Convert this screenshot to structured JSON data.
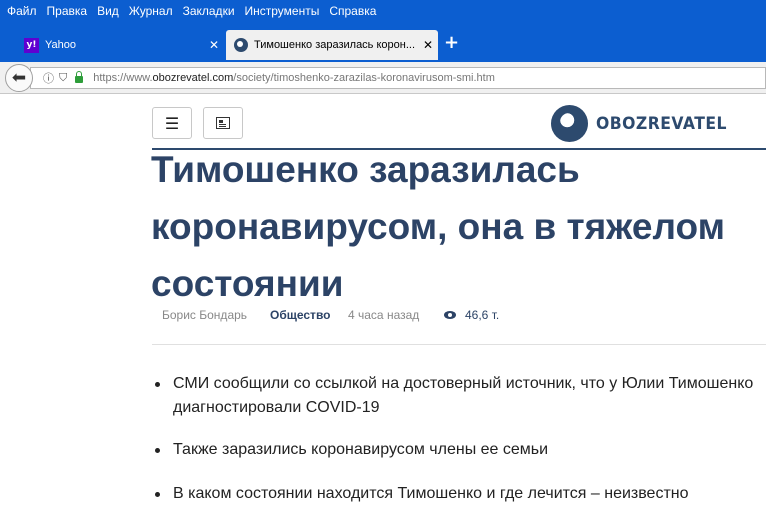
{
  "menu": [
    "Файл",
    "Правка",
    "Вид",
    "Журнал",
    "Закладки",
    "Инструменты",
    "Справка"
  ],
  "tabs": [
    {
      "title": "Yahoo",
      "favicon": "yahoo-icon"
    },
    {
      "title": "Тимошенко заразилась корон...",
      "favicon": "globe-icon"
    }
  ],
  "urlbar": {
    "url_prefix": "https://www.",
    "url_domain": "obozrevatel.com",
    "url_path": "/society/timoshenko-zarazilas-koronavirusom-smi.htm"
  },
  "brand": {
    "name": "OBOZREVATEL",
    "color": "#2d4a6e"
  },
  "article": {
    "headline": "Тимошенко заразилась коронавирусом, она в тяжелом состоянии",
    "author": "Борис Бондарь",
    "section": "Общество",
    "time": "4 часа назад",
    "views": "46,6 т.",
    "bullets": [
      "СМИ сообщили со ссылкой на достоверный источник, что у Юлии Тимошенко диагностировали COVID-19",
      "Также заразились коронавирусом члены ее семьи",
      "В каком состоянии находится Тимошенко и где лечится – неизвестно"
    ]
  },
  "colors": {
    "chrome_blue": "#0c5ed0",
    "headline": "#2c4366"
  }
}
